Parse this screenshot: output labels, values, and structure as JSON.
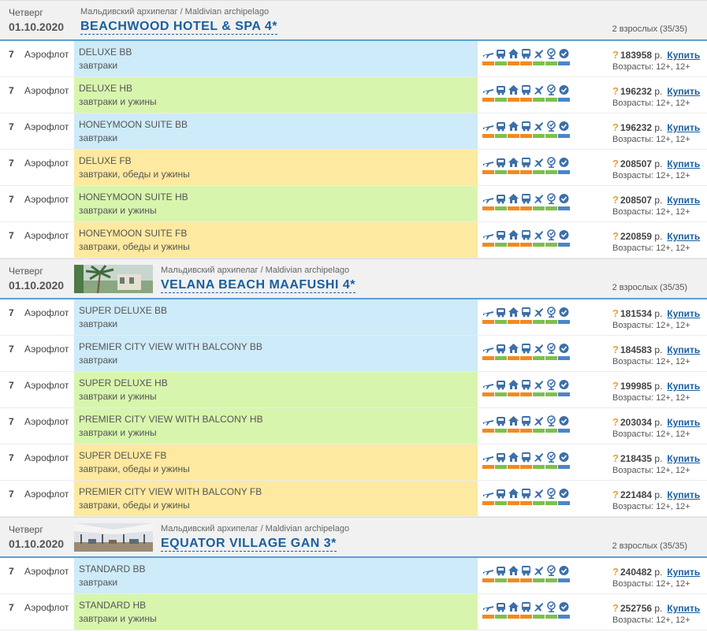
{
  "labels": {
    "buy": "Купить",
    "currency": "р.",
    "ages_prefix": "Возрасты:"
  },
  "colors": {
    "meal_bb": "#cdebf8",
    "meal_hb": "#d8f5ae",
    "meal_fb": "#fde99f",
    "bar_orange": "#f28a1e",
    "bar_green": "#7fbf4d",
    "bar_blue": "#4a86c8",
    "icon_blue": "#3d6fa8"
  },
  "service_icons": [
    {
      "name": "flight-icon",
      "bar": "orange"
    },
    {
      "name": "transfer-bus-icon",
      "bar": "green"
    },
    {
      "name": "hotel-icon",
      "bar": "orange"
    },
    {
      "name": "bus-icon",
      "bar": "orange"
    },
    {
      "name": "flight-return-icon",
      "bar": "green"
    },
    {
      "name": "insurance-icon",
      "bar": "green"
    },
    {
      "name": "visa-check-icon",
      "bar": "blue"
    }
  ],
  "hotels": [
    {
      "weekday": "Четверг",
      "date": "01.10.2020",
      "region": "Мальдивский архипелаг / Maldivian archipelago",
      "name": "BEACHWOOD HOTEL & SPA 4*",
      "guests": "2 взрослых (35/35)",
      "photo": "",
      "offers": [
        {
          "nights": "7",
          "airline": "Аэрофлот",
          "room": "DELUXE BB",
          "meal": "завтраки",
          "meal_type": "bb",
          "price": "183958",
          "ages": "12+, 12+"
        },
        {
          "nights": "7",
          "airline": "Аэрофлот",
          "room": "DELUXE HB",
          "meal": "завтраки и ужины",
          "meal_type": "hb",
          "price": "196232",
          "ages": "12+, 12+"
        },
        {
          "nights": "7",
          "airline": "Аэрофлот",
          "room": "HONEYMOON SUITE BB",
          "meal": "завтраки",
          "meal_type": "bb",
          "price": "196232",
          "ages": "12+, 12+"
        },
        {
          "nights": "7",
          "airline": "Аэрофлот",
          "room": "DELUXE FB",
          "meal": "завтраки, обеды и ужины",
          "meal_type": "fb",
          "price": "208507",
          "ages": "12+, 12+"
        },
        {
          "nights": "7",
          "airline": "Аэрофлот",
          "room": "HONEYMOON SUITE HB",
          "meal": "завтраки и ужины",
          "meal_type": "hb",
          "price": "208507",
          "ages": "12+, 12+"
        },
        {
          "nights": "7",
          "airline": "Аэрофлот",
          "room": "HONEYMOON SUITE FB",
          "meal": "завтраки, обеды и ужины",
          "meal_type": "fb",
          "price": "220859",
          "ages": "12+, 12+"
        }
      ]
    },
    {
      "weekday": "Четверг",
      "date": "01.10.2020",
      "region": "Мальдивский архипелаг / Maldivian archipelago",
      "name": "VELANA BEACH MAAFUSHI 4*",
      "guests": "2 взрослых (35/35)",
      "photo": "palm",
      "offers": [
        {
          "nights": "7",
          "airline": "Аэрофлот",
          "room": "SUPER DELUXE BB",
          "meal": "завтраки",
          "meal_type": "bb",
          "price": "181534",
          "ages": "12+, 12+"
        },
        {
          "nights": "7",
          "airline": "Аэрофлот",
          "room": "PREMIER CITY VIEW WITH BALCONY BB",
          "meal": "завтраки",
          "meal_type": "bb",
          "price": "184583",
          "ages": "12+, 12+"
        },
        {
          "nights": "7",
          "airline": "Аэрофлот",
          "room": "SUPER DELUXE HB",
          "meal": "завтраки и ужины",
          "meal_type": "hb",
          "price": "199985",
          "ages": "12+, 12+"
        },
        {
          "nights": "7",
          "airline": "Аэрофлот",
          "room": "PREMIER CITY VIEW WITH BALCONY HB",
          "meal": "завтраки и ужины",
          "meal_type": "hb",
          "price": "203034",
          "ages": "12+, 12+"
        },
        {
          "nights": "7",
          "airline": "Аэрофлот",
          "room": "SUPER DELUXE FB",
          "meal": "завтраки, обеды и ужины",
          "meal_type": "fb",
          "price": "218435",
          "ages": "12+, 12+"
        },
        {
          "nights": "7",
          "airline": "Аэрофлот",
          "room": "PREMIER CITY VIEW WITH BALCONY FB",
          "meal": "завтраки, обеды и ужины",
          "meal_type": "fb",
          "price": "221484",
          "ages": "12+, 12+"
        }
      ]
    },
    {
      "weekday": "Четверг",
      "date": "01.10.2020",
      "region": "Мальдивский архипелаг / Maldivian archipelago",
      "name": "EQUATOR VILLAGE GAN 3*",
      "guests": "2 взрослых (35/35)",
      "photo": "hall",
      "offers": [
        {
          "nights": "7",
          "airline": "Аэрофлот",
          "room": "STANDARD BB",
          "meal": "завтраки",
          "meal_type": "bb",
          "price": "240482",
          "ages": "12+, 12+"
        },
        {
          "nights": "7",
          "airline": "Аэрофлот",
          "room": "STANDARD HB",
          "meal": "завтраки и ужины",
          "meal_type": "hb",
          "price": "252756",
          "ages": "12+, 12+"
        }
      ]
    }
  ]
}
